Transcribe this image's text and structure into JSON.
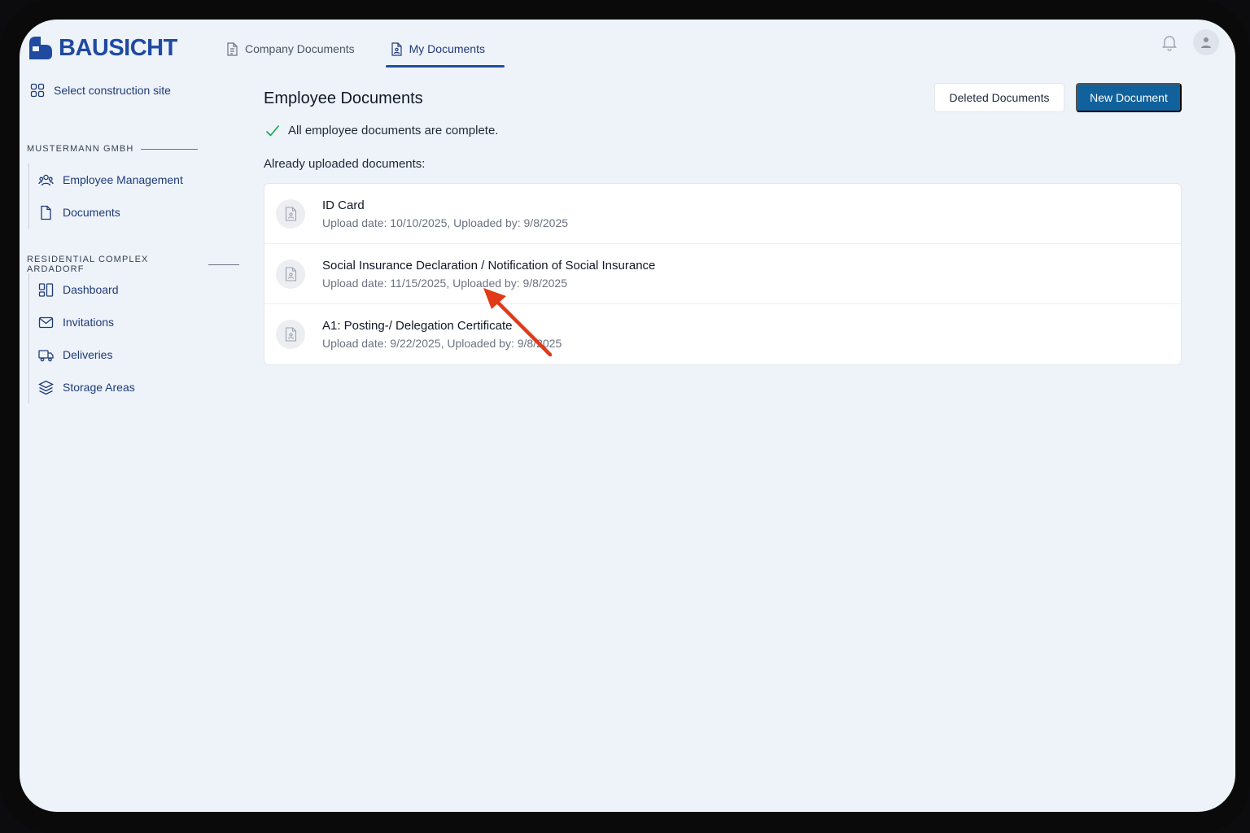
{
  "brand": {
    "name": "BAUSICHT",
    "color": "#1f4aa0"
  },
  "tabs": [
    {
      "label": "Company Documents",
      "icon": "document-icon",
      "active": false
    },
    {
      "label": "My Documents",
      "icon": "person-document-icon",
      "active": true
    }
  ],
  "header": {
    "notifications_icon": "bell-icon",
    "avatar_icon": "user-icon"
  },
  "sidebar": {
    "select_site": "Select construction site",
    "sections": [
      {
        "title": "MUSTERMANN GMBH",
        "items": [
          {
            "label": "Employee Management",
            "icon": "users-icon"
          },
          {
            "label": "Documents",
            "icon": "file-icon"
          }
        ]
      },
      {
        "title": "RESIDENTIAL COMPLEX ARDADORF",
        "items": [
          {
            "label": "Dashboard",
            "icon": "dashboard-icon"
          },
          {
            "label": "Invitations",
            "icon": "mail-icon"
          },
          {
            "label": "Deliveries",
            "icon": "truck-icon"
          },
          {
            "label": "Storage Areas",
            "icon": "layers-icon"
          }
        ]
      }
    ]
  },
  "main": {
    "title": "Employee Documents",
    "status": "All employee documents are complete.",
    "uploaded_label": "Already uploaded documents:",
    "deleted_button": "Deleted Documents",
    "new_button": "New Document",
    "documents": [
      {
        "name": "ID Card",
        "meta": "Upload date: 10/10/2025, Uploaded by: 9/8/2025"
      },
      {
        "name": "Social Insurance Declaration / Notification of Social Insurance",
        "meta": "Upload date: 11/15/2025, Uploaded by: 9/8/2025"
      },
      {
        "name": "A1: Posting-/ Delegation Certificate",
        "meta": "Upload date: 9/22/2025, Uploaded by: 9/8/2025"
      }
    ]
  },
  "colors": {
    "accent": "#11619c",
    "check": "#16a34a",
    "annotation_arrow": "#e03a1a"
  }
}
